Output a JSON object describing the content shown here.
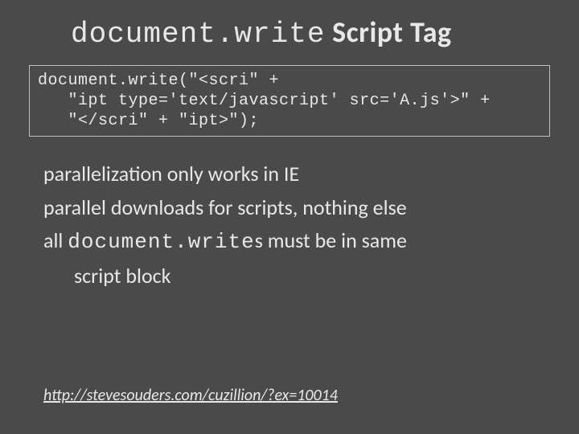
{
  "title": {
    "code_part": "document.write",
    "text_part": " Script Tag"
  },
  "code_lines": [
    "document.write(\"<scri\" +",
    "   \"ipt type='text/javascript' src='A.js'>\" +",
    "   \"</scri\" + \"ipt>\");"
  ],
  "body": {
    "line1": "parallelization only works in IE",
    "line2": "parallel downloads for scripts, nothing else",
    "line3_a": "all ",
    "line3_code": "document.write",
    "line3_b": "s must be in same",
    "line3_c": "script block"
  },
  "url": "http://stevesouders.com/cuzillion/?ex=10014"
}
